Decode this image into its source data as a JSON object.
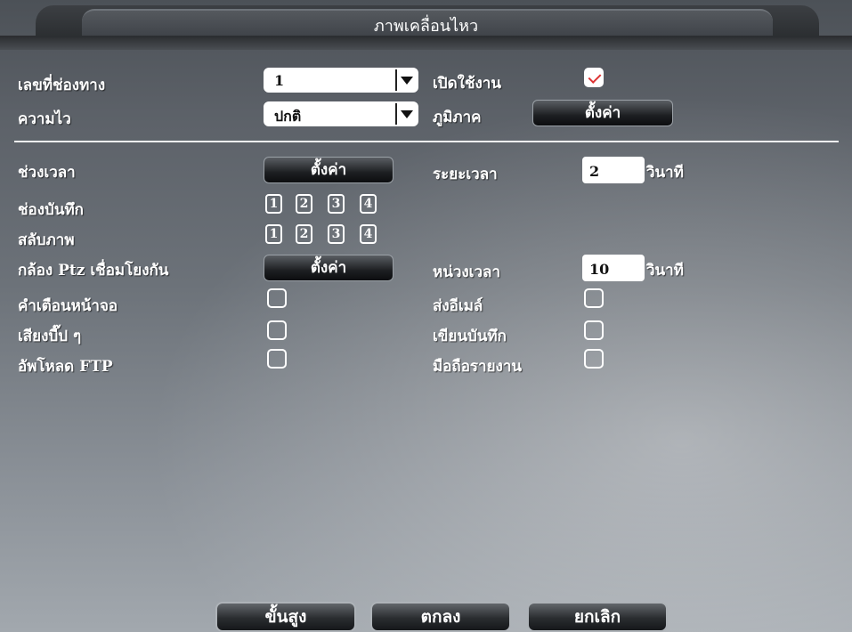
{
  "window": {
    "title": "ภาพเคลื่อนไหว"
  },
  "top": {
    "channel_label": "เลขที่ช่องทาง",
    "channel_value": "1",
    "enable_label": "เปิดใช้งาน",
    "enable_checked": true,
    "sensitivity_label": "ความไว",
    "sensitivity_value": "ปกติ",
    "region_label": "ภูมิภาค",
    "region_button": "ตั้งค่า"
  },
  "schedule": {
    "period_label": "ช่วงเวลา",
    "period_button": "ตั้งค่า",
    "interval_label": "ระยะเวลา",
    "interval_value": "2",
    "interval_unit": "วินาที"
  },
  "record_channel": {
    "label": "ช่องบันทึก",
    "channels": [
      "1",
      "2",
      "3",
      "4"
    ]
  },
  "switch_view": {
    "label": "สลับภาพ",
    "channels": [
      "1",
      "2",
      "3",
      "4"
    ]
  },
  "ptz": {
    "label": "กล้อง Ptz เชื่อมโยงกัน",
    "button": "ตั้งค่า",
    "delay_label": "หน่วงเวลา",
    "delay_value": "10",
    "delay_unit": "วินาที"
  },
  "options": {
    "screen_alert": "คำเตือนหน้าจอ",
    "send_email": "ส่งอีเมล์",
    "beep": "เสียงบี๊ป ๆ",
    "write_log": "เขียนบันทึก",
    "ftp_upload": "อัพโหลด FTP",
    "mobile_report": "มือถือรายงาน"
  },
  "footer": {
    "advanced": "ขั้นสูง",
    "ok": "ตกลง",
    "cancel": "ยกเลิก"
  }
}
